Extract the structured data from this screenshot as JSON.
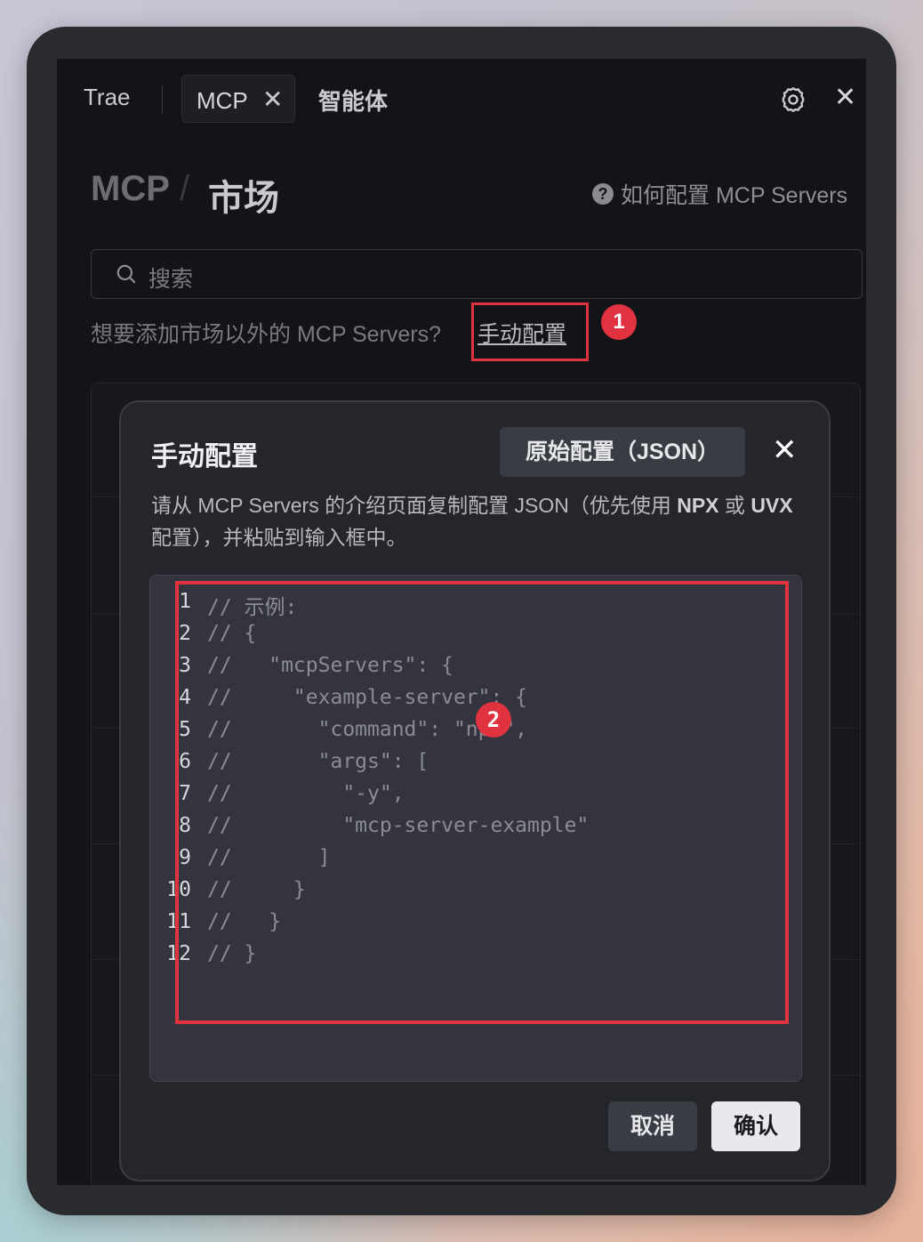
{
  "tabs": {
    "trae": "Trae",
    "mcp": "MCP",
    "mcp_close": "✕",
    "agent": "智能体",
    "close": "✕"
  },
  "header": {
    "crumb_mcp": "MCP",
    "crumb_sep": "/",
    "crumb_market": "市场",
    "help_icon": "?",
    "help_text": "如何配置 MCP Servers"
  },
  "search": {
    "placeholder": "搜索"
  },
  "hint": {
    "text": "想要添加市场以外的 MCP Servers?",
    "link": "手动配置"
  },
  "annotations": {
    "badge1": "1",
    "badge2": "2",
    "color": "#e0323f"
  },
  "dialog": {
    "title": "手动配置",
    "raw_button": "原始配置（JSON）",
    "close": "✕",
    "desc_1": "请从 MCP Servers 的介绍页面复制配置 JSON（优先使用 ",
    "desc_npx": "NPX",
    "desc_2": " 或 ",
    "desc_uvx": "UVX",
    "desc_3": " 配置），并粘贴到输入框中。",
    "code_lines": [
      {
        "n": "1",
        "text": "// 示例:"
      },
      {
        "n": "2",
        "text": "// {"
      },
      {
        "n": "3",
        "text": "//   \"mcpServers\": {"
      },
      {
        "n": "4",
        "text": "//     \"example-server\": {"
      },
      {
        "n": "5",
        "text": "//       \"command\": \"npx\","
      },
      {
        "n": "6",
        "text": "//       \"args\": ["
      },
      {
        "n": "7",
        "text": "//         \"-y\","
      },
      {
        "n": "8",
        "text": "//         \"mcp-server-example\""
      },
      {
        "n": "9",
        "text": "//       ]"
      },
      {
        "n": "10",
        "text": "//     }"
      },
      {
        "n": "11",
        "text": "//   }"
      },
      {
        "n": "12",
        "text": "// }"
      }
    ],
    "cancel": "取消",
    "confirm": "确认"
  }
}
